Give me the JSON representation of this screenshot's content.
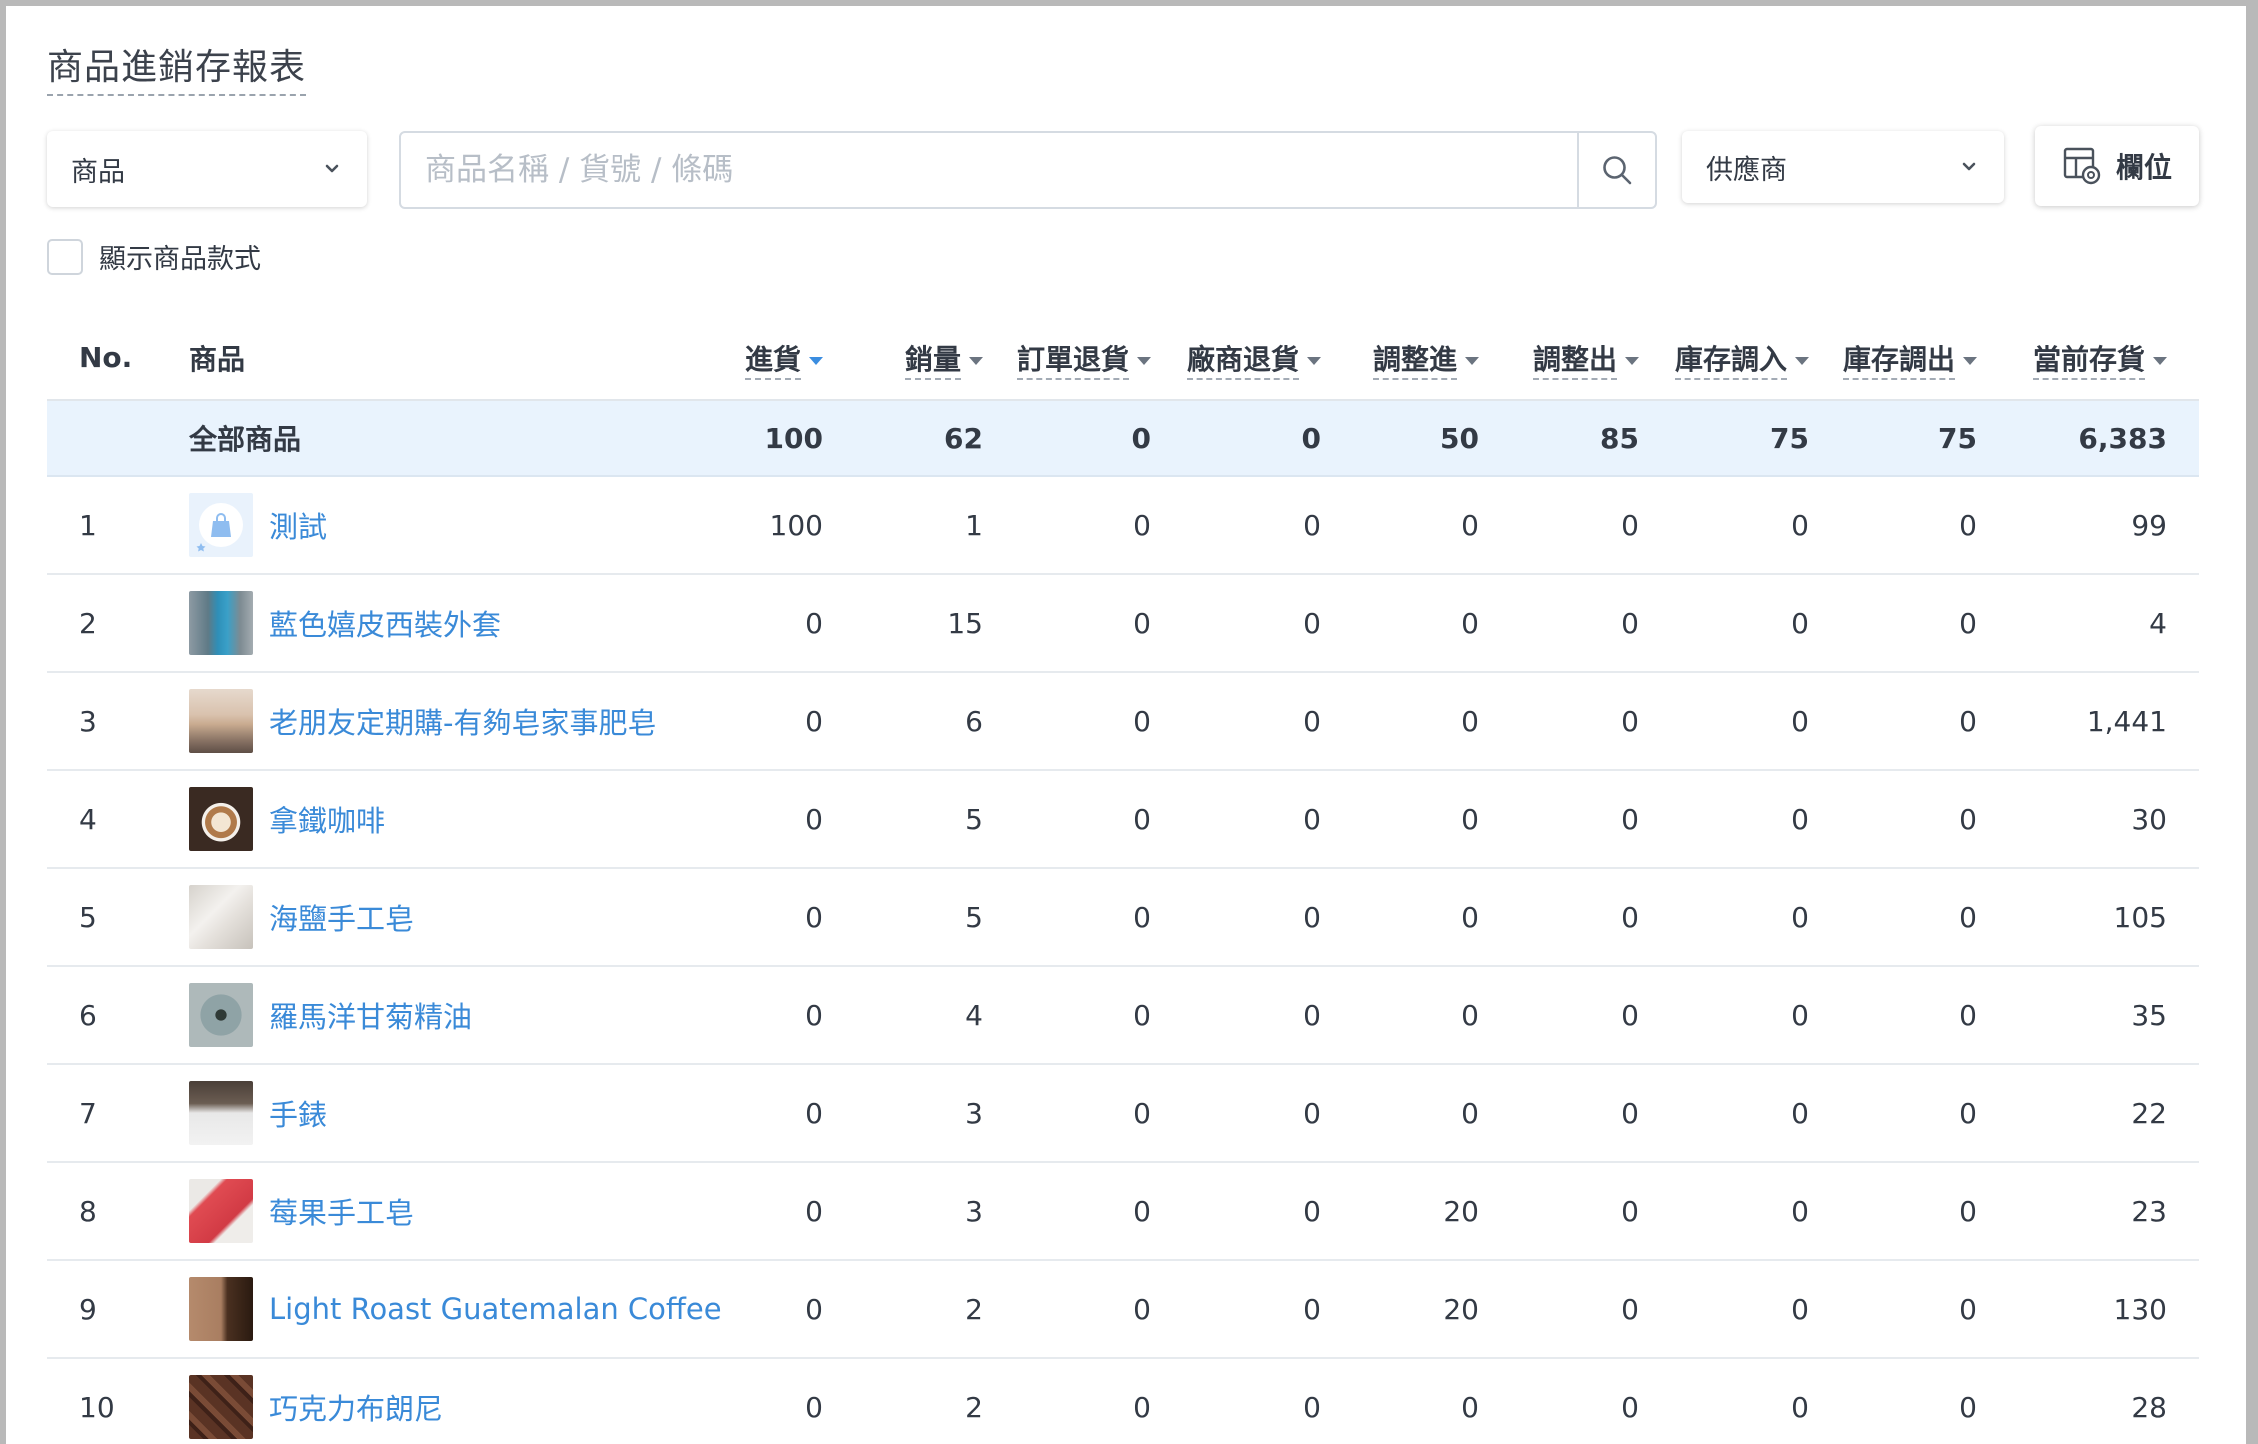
{
  "page": {
    "title": "商品進銷存報表"
  },
  "filters": {
    "type_select": {
      "value": "商品",
      "icon": "chevron-down-icon"
    },
    "search": {
      "value": "",
      "placeholder": "商品名稱 / 貨號 / 條碼",
      "icon": "search-icon"
    },
    "supplier_select": {
      "value": "供應商",
      "icon": "chevron-down-icon"
    },
    "columns_button": {
      "label": "欄位",
      "icon": "columns-settings-icon"
    },
    "show_variants": {
      "label": "顯示商品款式",
      "checked": false
    }
  },
  "table": {
    "headers": {
      "no": "No.",
      "product": "商品",
      "stock_in": "進貨",
      "sales": "銷量",
      "order_return": "訂單退貨",
      "vendor_return": "廠商退貨",
      "adjust_in": "調整進",
      "adjust_out": "調整出",
      "transfer_in": "庫存調入",
      "transfer_out": "庫存調出",
      "current_stock": "當前存貨"
    },
    "active_sort": "stock_in",
    "summary": {
      "label": "全部商品",
      "stock_in": "100",
      "sales": "62",
      "order_return": "0",
      "vendor_return": "0",
      "adjust_in": "50",
      "adjust_out": "85",
      "transfer_in": "75",
      "transfer_out": "75",
      "current_stock": "6,383"
    },
    "rows": [
      {
        "no": "1",
        "name": "測試",
        "thumb": "shopping-bag-placeholder",
        "stock_in": "100",
        "sales": "1",
        "order_return": "0",
        "vendor_return": "0",
        "adjust_in": "0",
        "adjust_out": "0",
        "transfer_in": "0",
        "transfer_out": "0",
        "current_stock": "99"
      },
      {
        "no": "2",
        "name": "藍色嬉皮西裝外套",
        "thumb": "blue-jacket-photo",
        "stock_in": "0",
        "sales": "15",
        "order_return": "0",
        "vendor_return": "0",
        "adjust_in": "0",
        "adjust_out": "0",
        "transfer_in": "0",
        "transfer_out": "0",
        "current_stock": "4"
      },
      {
        "no": "3",
        "name": "老朋友定期購-有夠皂家事肥皂",
        "thumb": "soap-bar-photo",
        "stock_in": "0",
        "sales": "6",
        "order_return": "0",
        "vendor_return": "0",
        "adjust_in": "0",
        "adjust_out": "0",
        "transfer_in": "0",
        "transfer_out": "0",
        "current_stock": "1,441"
      },
      {
        "no": "4",
        "name": "拿鐵咖啡",
        "thumb": "latte-photo",
        "stock_in": "0",
        "sales": "5",
        "order_return": "0",
        "vendor_return": "0",
        "adjust_in": "0",
        "adjust_out": "0",
        "transfer_in": "0",
        "transfer_out": "0",
        "current_stock": "30"
      },
      {
        "no": "5",
        "name": "海鹽手工皂",
        "thumb": "sea-salt-soap-photo",
        "stock_in": "0",
        "sales": "5",
        "order_return": "0",
        "vendor_return": "0",
        "adjust_in": "0",
        "adjust_out": "0",
        "transfer_in": "0",
        "transfer_out": "0",
        "current_stock": "105"
      },
      {
        "no": "6",
        "name": "羅馬洋甘菊精油",
        "thumb": "essential-oil-photo",
        "stock_in": "0",
        "sales": "4",
        "order_return": "0",
        "vendor_return": "0",
        "adjust_in": "0",
        "adjust_out": "0",
        "transfer_in": "0",
        "transfer_out": "0",
        "current_stock": "35"
      },
      {
        "no": "7",
        "name": "手錶",
        "thumb": "watch-photo",
        "stock_in": "0",
        "sales": "3",
        "order_return": "0",
        "vendor_return": "0",
        "adjust_in": "0",
        "adjust_out": "0",
        "transfer_in": "0",
        "transfer_out": "0",
        "current_stock": "22"
      },
      {
        "no": "8",
        "name": "莓果手工皂",
        "thumb": "berry-soap-photo",
        "stock_in": "0",
        "sales": "3",
        "order_return": "0",
        "vendor_return": "0",
        "adjust_in": "20",
        "adjust_out": "0",
        "transfer_in": "0",
        "transfer_out": "0",
        "current_stock": "23"
      },
      {
        "no": "9",
        "name": "Light Roast Guatemalan Coffee",
        "thumb": "coffee-beans-photo",
        "stock_in": "0",
        "sales": "2",
        "order_return": "0",
        "vendor_return": "0",
        "adjust_in": "20",
        "adjust_out": "0",
        "transfer_in": "0",
        "transfer_out": "0",
        "current_stock": "130"
      },
      {
        "no": "10",
        "name": "巧克力布朗尼",
        "thumb": "brownie-photo",
        "stock_in": "0",
        "sales": "2",
        "order_return": "0",
        "vendor_return": "0",
        "adjust_in": "0",
        "adjust_out": "0",
        "transfer_in": "0",
        "transfer_out": "0",
        "current_stock": "28"
      }
    ]
  }
}
